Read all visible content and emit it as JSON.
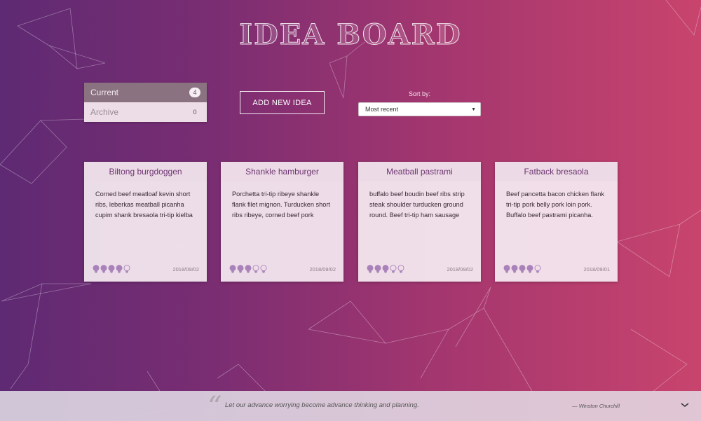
{
  "header": {
    "title": "IDEA BOARD"
  },
  "sidebar": {
    "items": [
      {
        "label": "Current",
        "count": "4",
        "active": true
      },
      {
        "label": "Archive",
        "count": "0",
        "active": false
      }
    ]
  },
  "toolbar": {
    "add_label": "ADD NEW IDEA",
    "sort_label": "Sort by:",
    "sort_value": "Most recent"
  },
  "cards": [
    {
      "title": "Biltong burgdoggen",
      "body": "Corned beef meatloaf kevin short ribs, leberkas meatball picanha cupim shank bresaola tri-tip kielba",
      "rating": 4,
      "date": "2018/09/02"
    },
    {
      "title": "Shankle hamburger",
      "body": "Porchetta tri-tip ribeye shankle flank filet mignon. Turducken short ribs ribeye, corned beef pork",
      "rating": 3,
      "date": "2018/09/02"
    },
    {
      "title": "Meatball pastrami",
      "body": "buffalo beef boudin beef ribs strip steak shoulder turducken ground round. Beef tri-tip ham sausage",
      "rating": 3,
      "date": "2018/09/02"
    },
    {
      "title": "Fatback bresaola",
      "body": "Beef pancetta bacon chicken flank tri-tip pork belly pork loin pork. Buffalo beef pastrami picanha.",
      "rating": 4,
      "date": "2018/09/01"
    }
  ],
  "footer": {
    "quote_mark": "“",
    "quote": "Let our advance worrying become advance thinking and planning.",
    "author": "— Winston Churchill"
  },
  "colors": {
    "background_start": "#5e2a73",
    "background_end": "#c8446d",
    "accent": "#6e3572",
    "bulb_fill": "#a982ba"
  },
  "icons": {
    "bulb": "lightbulb-icon",
    "chevron": "chevron-down-icon",
    "select_arrow": "caret-down-icon"
  }
}
